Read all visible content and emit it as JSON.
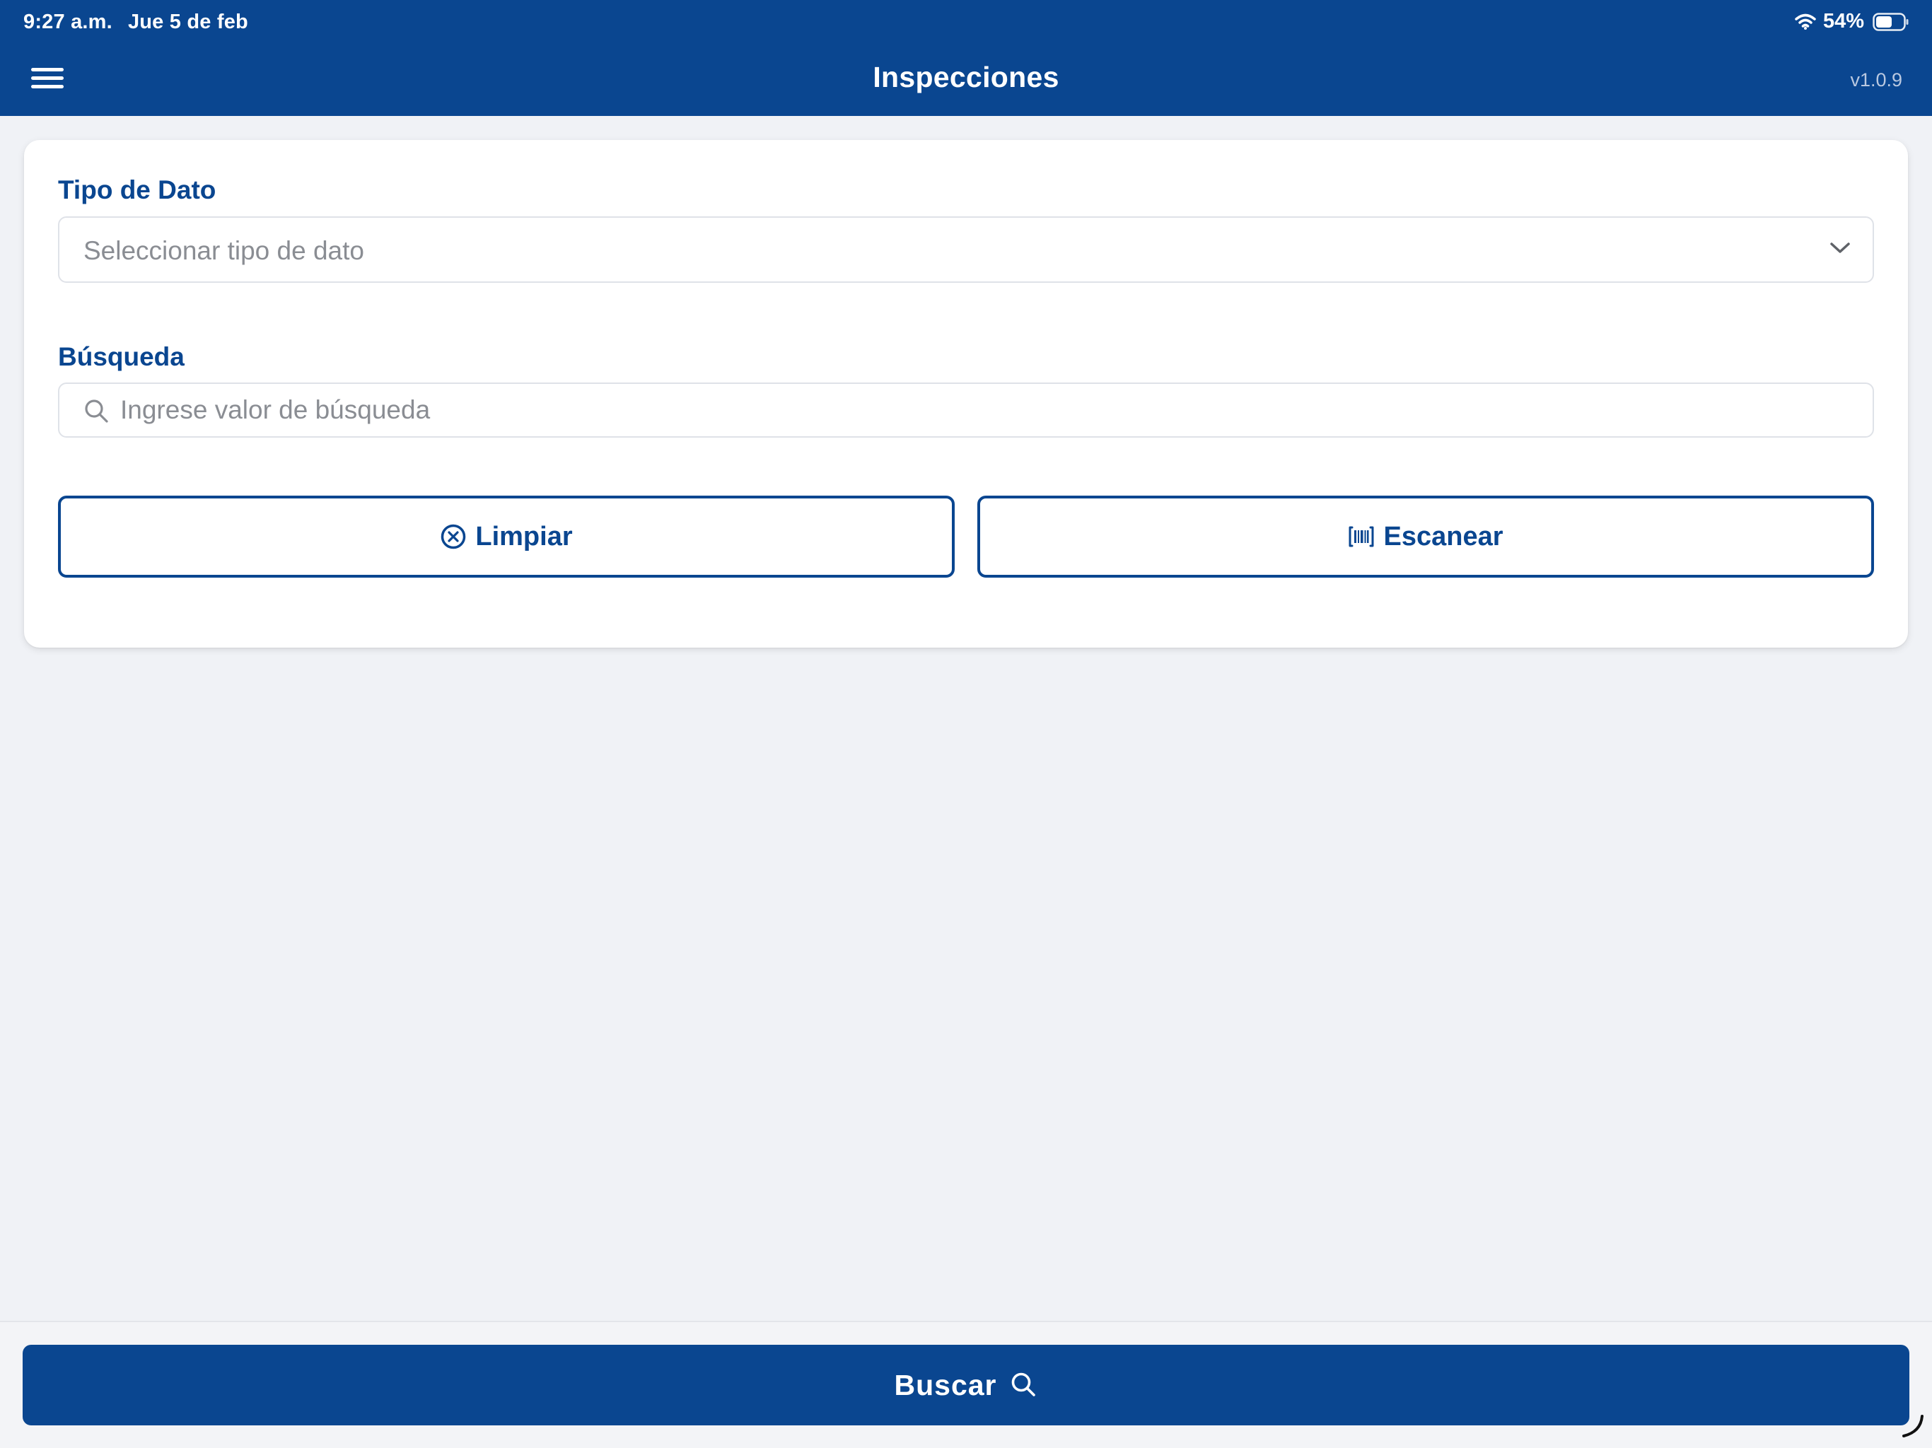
{
  "status_bar": {
    "time": "9:27 a.m.",
    "date": "Jue 5 de feb",
    "battery": "54%",
    "icons": [
      "wifi-icon",
      "battery-icon"
    ]
  },
  "header": {
    "title": "Inspecciones",
    "version": "v1.0.9",
    "menu_icon": "hamburger-menu-icon"
  },
  "form": {
    "data_type": {
      "label": "Tipo de Dato",
      "placeholder": "Seleccionar tipo de dato",
      "icon": "chevron-down-icon"
    },
    "search": {
      "label": "Búsqueda",
      "placeholder": "Ingrese valor de búsqueda",
      "value": "",
      "icon": "search-icon"
    },
    "buttons": {
      "clear_label": "Limpiar",
      "clear_icon": "clear-circle-icon",
      "scan_label": "Escanear",
      "scan_icon": "barcode-scan-icon"
    }
  },
  "footer": {
    "search_label": "Buscar",
    "search_icon": "search-icon"
  },
  "colors": {
    "primary": "#0a4690",
    "background": "#f0f2f6",
    "card": "#ffffff",
    "placeholder": "#8a8d93",
    "border": "#dfe2e8"
  }
}
